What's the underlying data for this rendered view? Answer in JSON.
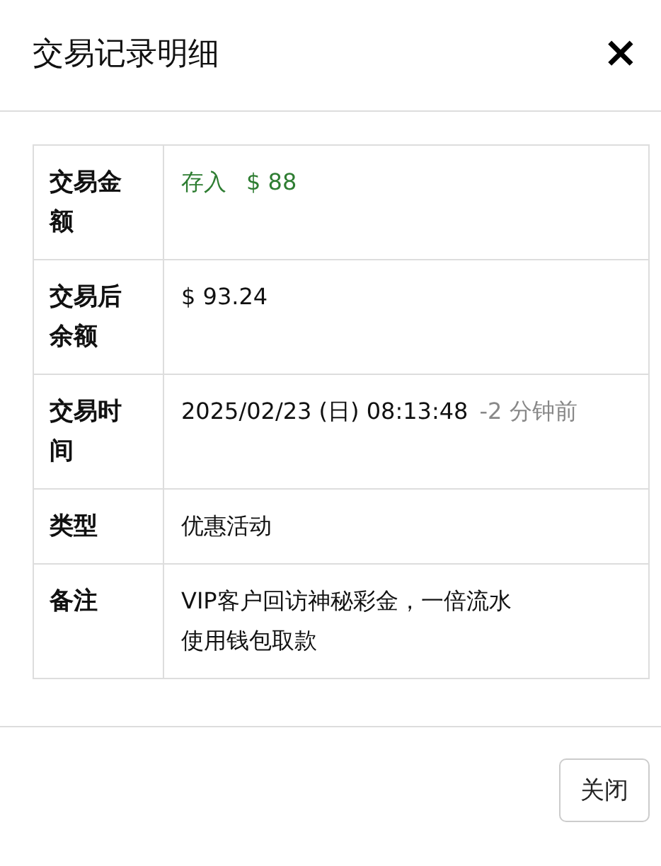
{
  "dialog": {
    "title": "交易记录明细",
    "close_icon": "×"
  },
  "rows": [
    {
      "label": "交易金额",
      "lines": [
        [
          {
            "text": "存入",
            "kind": "positive"
          },
          {
            "text": "$ 88",
            "kind": "positive"
          }
        ]
      ]
    },
    {
      "label": "交易后余额",
      "lines": [
        [
          {
            "text": "$ 93.24",
            "kind": "normal"
          }
        ]
      ]
    },
    {
      "label": "交易时间",
      "lines": [
        [
          {
            "text": "2025/02/23 (日) 08:13:48",
            "kind": "normal"
          },
          {
            "text": "-2 分钟前",
            "kind": "muted"
          }
        ]
      ]
    },
    {
      "label": "类型",
      "lines": [
        [
          {
            "text": "优惠活动",
            "kind": "normal"
          }
        ]
      ]
    },
    {
      "label": "备注",
      "lines": [
        [
          {
            "text": "VIP客户回访神秘彩金，一倍流水",
            "kind": "normal"
          }
        ],
        [
          {
            "text": "使用钱包取款",
            "kind": "normal"
          }
        ]
      ]
    }
  ],
  "buttons": [
    "关闭"
  ]
}
